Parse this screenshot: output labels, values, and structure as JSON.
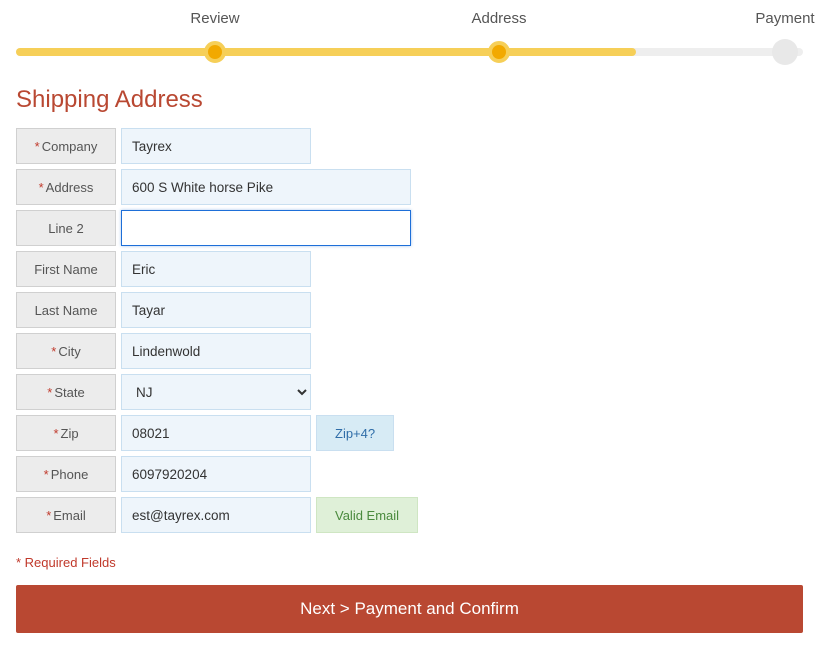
{
  "progress": {
    "steps": [
      "Review",
      "Address",
      "Payment"
    ]
  },
  "heading": "Shipping Address",
  "form": {
    "company": {
      "label": "Company",
      "value": "Tayrex",
      "required": true,
      "width": "normal"
    },
    "address": {
      "label": "Address",
      "value": "600 S White horse Pike",
      "required": true,
      "width": "wide"
    },
    "line2": {
      "label": "Line 2",
      "value": "",
      "required": false,
      "width": "wide"
    },
    "firstname": {
      "label": "First Name",
      "value": "Eric",
      "required": false,
      "width": "normal"
    },
    "lastname": {
      "label": "Last Name",
      "value": "Tayar",
      "required": false,
      "width": "normal"
    },
    "city": {
      "label": "City",
      "value": "Lindenwold",
      "required": true,
      "width": "normal"
    },
    "state": {
      "label": "State",
      "value": "NJ",
      "required": true,
      "width": "normal"
    },
    "zip": {
      "label": "Zip",
      "value": "08021",
      "required": true,
      "width": "normal",
      "badge": {
        "text": "Zip+4?",
        "kind": "link"
      }
    },
    "phone": {
      "label": "Phone",
      "value": "6097920204",
      "required": true,
      "width": "normal"
    },
    "email": {
      "label": "Email",
      "value": "est@tayrex.com",
      "required": true,
      "width": "normal",
      "badge": {
        "text": "Valid Email",
        "kind": "ok"
      }
    }
  },
  "req_note": "* Required Fields",
  "next_button": "Next > Payment and Confirm"
}
